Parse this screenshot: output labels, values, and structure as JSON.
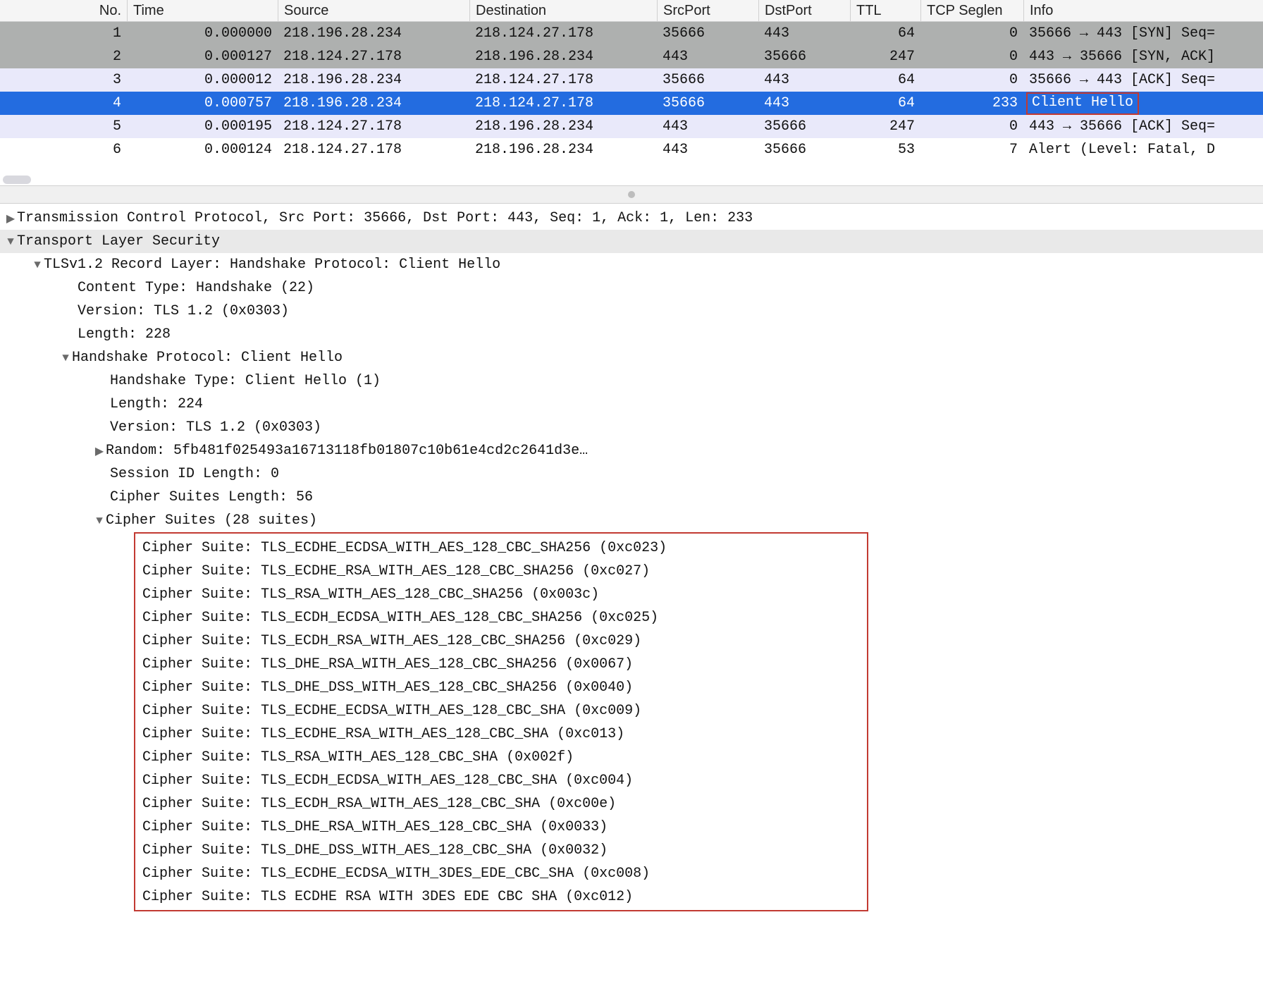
{
  "headers": {
    "no": "No.",
    "time": "Time",
    "src": "Source",
    "dst": "Destination",
    "sport": "SrcPort",
    "dport": "DstPort",
    "ttl": "TTL",
    "seg": "TCP Seglen",
    "info": "Info"
  },
  "rows": [
    {
      "no": "1",
      "time": "0.000000",
      "src": "218.196.28.234",
      "dst": "218.124.27.178",
      "sport": "35666",
      "dport": "443",
      "ttl": "64",
      "seg": "0",
      "info": "35666 → 443 [SYN] Seq=",
      "variant": "v-grey"
    },
    {
      "no": "2",
      "time": "0.000127",
      "src": "218.124.27.178",
      "dst": "218.196.28.234",
      "sport": "443",
      "dport": "35666",
      "ttl": "247",
      "seg": "0",
      "info": "443 → 35666 [SYN, ACK]",
      "variant": "v-grey"
    },
    {
      "no": "3",
      "time": "0.000012",
      "src": "218.196.28.234",
      "dst": "218.124.27.178",
      "sport": "35666",
      "dport": "443",
      "ttl": "64",
      "seg": "0",
      "info": "35666 → 443 [ACK] Seq=",
      "variant": "v-lav"
    },
    {
      "no": "4",
      "time": "0.000757",
      "src": "218.196.28.234",
      "dst": "218.124.27.178",
      "sport": "35666",
      "dport": "443",
      "ttl": "64",
      "seg": "233",
      "info": "Client Hello",
      "variant": "v-sel",
      "highlight_info": true
    },
    {
      "no": "5",
      "time": "0.000195",
      "src": "218.124.27.178",
      "dst": "218.196.28.234",
      "sport": "443",
      "dport": "35666",
      "ttl": "247",
      "seg": "0",
      "info": "443 → 35666 [ACK] Seq=",
      "variant": "v-lav"
    },
    {
      "no": "6",
      "time": "0.000124",
      "src": "218.124.27.178",
      "dst": "218.196.28.234",
      "sport": "443",
      "dport": "35666",
      "ttl": "53",
      "seg": "7",
      "info": "Alert (Level: Fatal, D",
      "variant": "v-white"
    }
  ],
  "tree": {
    "tcp_line": "Transmission Control Protocol, Src Port: 35666, Dst Port: 443, Seq: 1, Ack: 1, Len: 233",
    "tls_line": "Transport Layer Security",
    "record_line": "TLSv1.2 Record Layer: Handshake Protocol: Client Hello",
    "content_type": "Content Type: Handshake (22)",
    "rec_version": "Version: TLS 1.2 (0x0303)",
    "rec_length": "Length: 228",
    "hs_line": "Handshake Protocol: Client Hello",
    "hs_type": "Handshake Type: Client Hello (1)",
    "hs_length": "Length: 224",
    "hs_version": "Version: TLS 1.2 (0x0303)",
    "random": "Random: 5fb481f025493a16713118fb01807c10b61e4cd2c2641d3e…",
    "session_id_len": "Session ID Length: 0",
    "cs_len": "Cipher Suites Length: 56",
    "cs_header": "Cipher Suites (28 suites)"
  },
  "suites": [
    "Cipher Suite: TLS_ECDHE_ECDSA_WITH_AES_128_CBC_SHA256 (0xc023)",
    "Cipher Suite: TLS_ECDHE_RSA_WITH_AES_128_CBC_SHA256 (0xc027)",
    "Cipher Suite: TLS_RSA_WITH_AES_128_CBC_SHA256 (0x003c)",
    "Cipher Suite: TLS_ECDH_ECDSA_WITH_AES_128_CBC_SHA256 (0xc025)",
    "Cipher Suite: TLS_ECDH_RSA_WITH_AES_128_CBC_SHA256 (0xc029)",
    "Cipher Suite: TLS_DHE_RSA_WITH_AES_128_CBC_SHA256 (0x0067)",
    "Cipher Suite: TLS_DHE_DSS_WITH_AES_128_CBC_SHA256 (0x0040)",
    "Cipher Suite: TLS_ECDHE_ECDSA_WITH_AES_128_CBC_SHA (0xc009)",
    "Cipher Suite: TLS_ECDHE_RSA_WITH_AES_128_CBC_SHA (0xc013)",
    "Cipher Suite: TLS_RSA_WITH_AES_128_CBC_SHA (0x002f)",
    "Cipher Suite: TLS_ECDH_ECDSA_WITH_AES_128_CBC_SHA (0xc004)",
    "Cipher Suite: TLS_ECDH_RSA_WITH_AES_128_CBC_SHA (0xc00e)",
    "Cipher Suite: TLS_DHE_RSA_WITH_AES_128_CBC_SHA (0x0033)",
    "Cipher Suite: TLS_DHE_DSS_WITH_AES_128_CBC_SHA (0x0032)",
    "Cipher Suite: TLS_ECDHE_ECDSA_WITH_3DES_EDE_CBC_SHA (0xc008)",
    "Cipher Suite: TLS ECDHE RSA WITH 3DES EDE CBC SHA (0xc012)"
  ]
}
